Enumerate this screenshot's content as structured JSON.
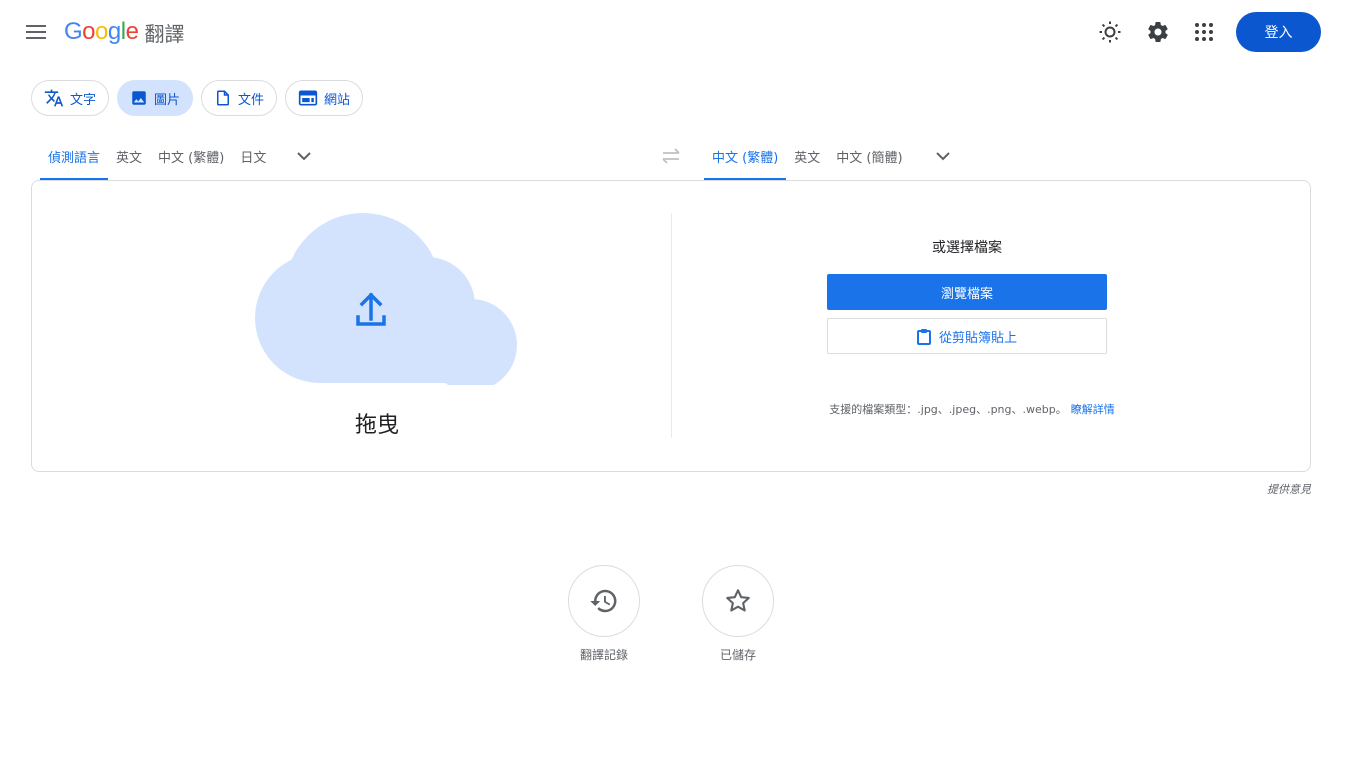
{
  "header": {
    "logo_text": "Google",
    "product_name": "翻譯",
    "signin_label": "登入",
    "icons": [
      "menu-icon",
      "theme-sun-icon",
      "settings-gear-icon",
      "apps-grid-icon"
    ]
  },
  "modes": [
    {
      "label": "文字",
      "icon": "translate-icon",
      "active": false
    },
    {
      "label": "圖片",
      "icon": "image-icon",
      "active": true
    },
    {
      "label": "文件",
      "icon": "document-icon",
      "active": false
    },
    {
      "label": "網站",
      "icon": "website-icon",
      "active": false
    }
  ],
  "source_langs": [
    "偵測語言",
    "英文",
    "中文 (繁體)",
    "日文"
  ],
  "target_langs": [
    "中文 (繁體)",
    "英文",
    "中文 (簡體)"
  ],
  "upload": {
    "drop_label": "拖曳",
    "or_choose": "或選擇檔案",
    "browse_label": "瀏覽檔案",
    "paste_label": "從剪貼簿貼上",
    "support_text": "支援的檔案類型：.jpg、.jpeg、.png、.webp。",
    "learn_more": "瞭解詳情"
  },
  "feedback_label": "提供意見",
  "bottom": {
    "history_label": "翻譯記錄",
    "saved_label": "已儲存"
  },
  "colors": {
    "accent": "#1a73e8",
    "signin_bg": "#0b57d0",
    "active_tab_bg": "#d3e3fd",
    "cloud": "#d3e3fd"
  }
}
